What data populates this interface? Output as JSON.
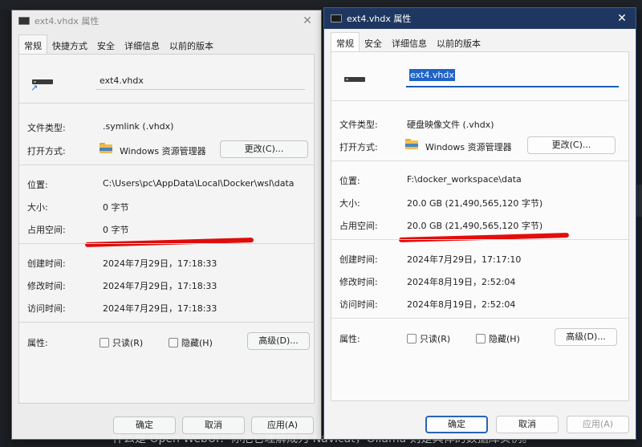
{
  "background": {
    "caption": "什么是 Open WebUI？你把它理解成为 Navicat，Ollama 则是具体的数据库实例。"
  },
  "labels": {
    "file_type": "文件类型:",
    "open_with": "打开方式:",
    "location": "位置:",
    "size": "大小:",
    "size_on_disk": "占用空间:",
    "created": "创建时间:",
    "modified": "修改时间:",
    "accessed": "访问时间:",
    "attributes": "属性:"
  },
  "left_window": {
    "title": "ext4.vhdx 属性",
    "close_glyph": "✕",
    "tabs": [
      "常规",
      "快捷方式",
      "安全",
      "详细信息",
      "以前的版本"
    ],
    "active_tab": 0,
    "file_name": "ext4.vhdx",
    "file_type": ".symlink (.vhdx)",
    "open_with_app": "Windows 资源管理器",
    "change_button": "更改(C)...",
    "location": "C:\\Users\\pc\\AppData\\Local\\Docker\\wsl\\data",
    "size": "0 字节",
    "size_on_disk": "0 字节",
    "created": "2024年7月29日，17:18:33",
    "modified": "2024年7月29日，17:18:33",
    "accessed": "2024年7月29日，17:18:33",
    "readonly_label": "只读(R)",
    "hidden_label": "隐藏(H)",
    "advanced_button": "高级(D)...",
    "ok_button": "确定",
    "cancel_button": "取消",
    "apply_button": "应用(A)",
    "icon": "shortcut-drive-icon"
  },
  "right_window": {
    "title": "ext4.vhdx 属性",
    "close_glyph": "✕",
    "tabs": [
      "常规",
      "安全",
      "详细信息",
      "以前的版本"
    ],
    "active_tab": 0,
    "file_name": "ext4.vhdx",
    "file_type": "硬盘映像文件 (.vhdx)",
    "open_with_app": "Windows 资源管理器",
    "change_button": "更改(C)...",
    "location": "F:\\docker_workspace\\data",
    "size": "20.0 GB (21,490,565,120 字节)",
    "size_on_disk": "20.0 GB (21,490,565,120 字节)",
    "created": "2024年7月29日，17:17:10",
    "modified": "2024年8月19日，2:52:04",
    "accessed": "2024年8月19日，2:52:04",
    "readonly_label": "只读(R)",
    "hidden_label": "隐藏(H)",
    "advanced_button": "高级(D)...",
    "ok_button": "确定",
    "cancel_button": "取消",
    "apply_button": "应用(A)",
    "icon": "drive-icon"
  },
  "colors": {
    "titlebar_active": "#1f3760",
    "selection": "#1e63c8",
    "annotation_red": "#e50c0c",
    "folder": "#f5c04e"
  }
}
